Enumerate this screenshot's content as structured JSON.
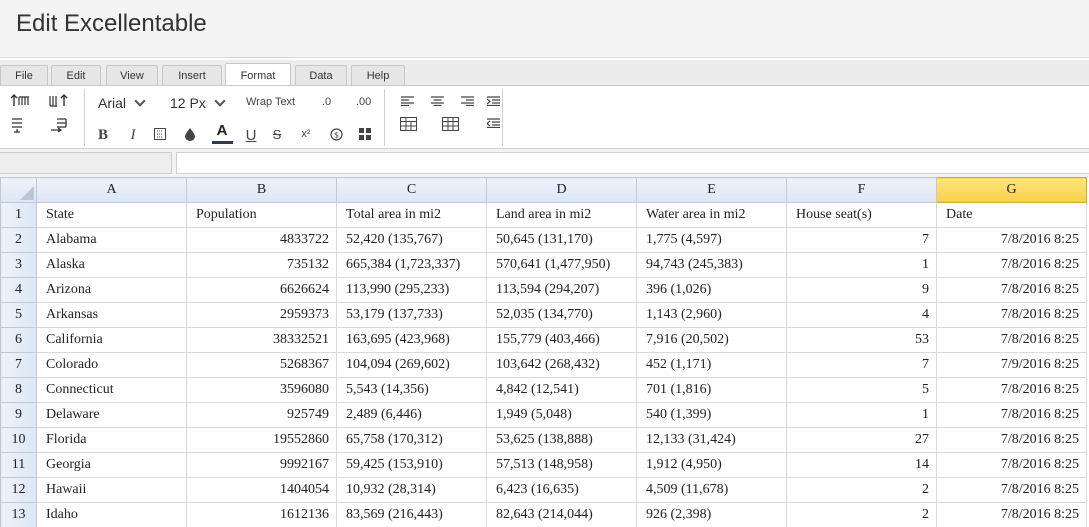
{
  "window": {
    "title": "Edit Excellentable"
  },
  "menu_tabs": [
    {
      "label": "File"
    },
    {
      "label": "Edit"
    },
    {
      "label": "View"
    },
    {
      "label": "Insert"
    },
    {
      "label": "Format",
      "active": true
    },
    {
      "label": "Data"
    },
    {
      "label": "Help"
    }
  ],
  "toolbar": {
    "font_family": "Arial",
    "font_size": "12 Px",
    "wrap_text": "Wrap Text",
    "decrease_decimal": ".0",
    "increase_decimal": ".00",
    "bold": "B",
    "italic": "I",
    "font_color": "A",
    "underline": "U",
    "strike": "S",
    "superscript": "x²"
  },
  "formula_bar": {
    "cell_ref": "",
    "value": ""
  },
  "sheet": {
    "selected_column": "G",
    "columns": [
      "A",
      "B",
      "C",
      "D",
      "E",
      "F",
      "G"
    ],
    "rows": [
      {
        "n": "1",
        "cells": [
          "State",
          "Population",
          "Total area in mi2",
          "Land area in mi2",
          "Water area in mi2",
          "House seat(s)",
          "Date"
        ]
      },
      {
        "n": "2",
        "cells": [
          "Alabama",
          "4833722",
          "52,420 (135,767)",
          "50,645 (131,170)",
          "1,775 (4,597)",
          "7",
          "7/8/2016 8:25"
        ]
      },
      {
        "n": "3",
        "cells": [
          "Alaska",
          "735132",
          "665,384 (1,723,337)",
          "570,641 (1,477,950)",
          "94,743 (245,383)",
          "1",
          "7/8/2016 8:25"
        ]
      },
      {
        "n": "4",
        "cells": [
          "Arizona",
          "6626624",
          "113,990 (295,233)",
          "113,594 (294,207)",
          "396 (1,026)",
          "9",
          "7/8/2016 8:25"
        ]
      },
      {
        "n": "5",
        "cells": [
          "Arkansas",
          "2959373",
          "53,179 (137,733)",
          "52,035 (134,770)",
          "1,143 (2,960)",
          "4",
          "7/8/2016 8:25"
        ]
      },
      {
        "n": "6",
        "cells": [
          "California",
          "38332521",
          "163,695 (423,968)",
          "155,779 (403,466)",
          "7,916 (20,502)",
          "53",
          "7/8/2016 8:25"
        ]
      },
      {
        "n": "7",
        "cells": [
          "Colorado",
          "5268367",
          "104,094 (269,602)",
          "103,642 (268,432)",
          "452 (1,171)",
          "7",
          "7/9/2016 8:25"
        ]
      },
      {
        "n": "8",
        "cells": [
          "Connecticut",
          "3596080",
          "5,543 (14,356)",
          "4,842 (12,541)",
          "701 (1,816)",
          "5",
          "7/8/2016 8:25"
        ]
      },
      {
        "n": "9",
        "cells": [
          "Delaware",
          "925749",
          "2,489 (6,446)",
          "1,949 (5,048)",
          "540 (1,399)",
          "1",
          "7/8/2016 8:25"
        ]
      },
      {
        "n": "10",
        "cells": [
          "Florida",
          "19552860",
          "65,758 (170,312)",
          "53,625 (138,888)",
          "12,133 (31,424)",
          "27",
          "7/8/2016 8:25"
        ]
      },
      {
        "n": "11",
        "cells": [
          "Georgia",
          "9992167",
          "59,425 (153,910)",
          "57,513 (148,958)",
          "1,912 (4,950)",
          "14",
          "7/8/2016 8:25"
        ]
      },
      {
        "n": "12",
        "cells": [
          "Hawaii",
          "1404054",
          "10,932 (28,314)",
          "6,423 (16,635)",
          "4,509 (11,678)",
          "2",
          "7/8/2016 8:25"
        ]
      },
      {
        "n": "13",
        "cells": [
          "Idaho",
          "1612136",
          "83,569 (216,443)",
          "82,643 (214,044)",
          "926 (2,398)",
          "2",
          "7/8/2016 8:25"
        ]
      }
    ]
  }
}
